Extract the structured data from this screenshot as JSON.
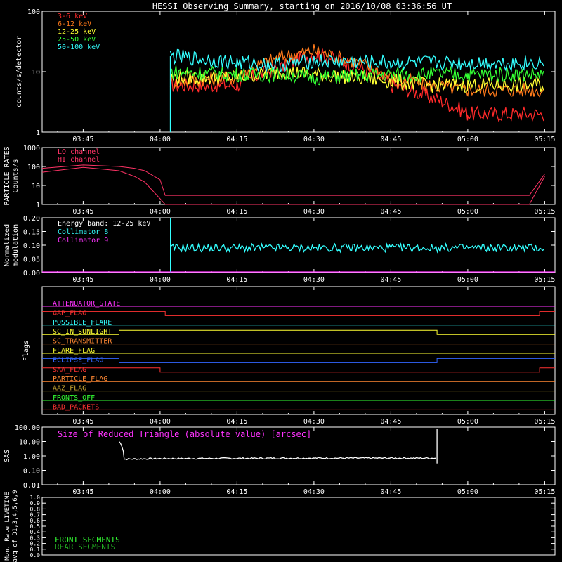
{
  "title": "HESSI Observing Summary, starting on 2016/10/08 03:36:56 UT",
  "time_ticks": [
    "03:45",
    "04:00",
    "04:15",
    "04:30",
    "04:45",
    "05:00",
    "05:15"
  ],
  "colors": {
    "background": "#000000",
    "axes": "#ffffff",
    "e3_6": "#ff2a2a",
    "e6_12": "#ff7a1a",
    "e12_25": "#ffff33",
    "e25_50": "#33ff33",
    "e50_100": "#33ffff",
    "particle_lo": "#ff3366",
    "particle_hi": "#ff3366",
    "coll8": "#33ffff",
    "coll9": "#ff33ff",
    "sas_title": "#ff33ff",
    "front_segments": "#33ff33",
    "rear_segments": "#22aa22"
  },
  "chart_data": [
    {
      "type": "line",
      "panel": "lightcurves",
      "ylabel": "counts/s/detector",
      "yscale": "log",
      "ylim": [
        1,
        100
      ],
      "ytick_labels": [
        "1",
        "10",
        "100"
      ],
      "legend": [
        "3-6 keV",
        "6-12 keV",
        "12-25 keV",
        "25-50 keV",
        "50-100 keV"
      ],
      "x": [
        "04:02",
        "04:15",
        "04:24",
        "04:30",
        "04:45",
        "04:52",
        "05:00",
        "05:15"
      ],
      "series": [
        {
          "name": "3-6 keV",
          "values": [
            6,
            6,
            12,
            20,
            6,
            4,
            2,
            2
          ]
        },
        {
          "name": "6-12 keV",
          "values": [
            7,
            8,
            18,
            22,
            8,
            6,
            5,
            5
          ]
        },
        {
          "name": "12-25 keV",
          "values": [
            8,
            8,
            10,
            9,
            7,
            6,
            6,
            6
          ]
        },
        {
          "name": "25-50 keV",
          "values": [
            10,
            9,
            9,
            8,
            9,
            9,
            9,
            9
          ]
        },
        {
          "name": "50-100 keV",
          "values": [
            18,
            14,
            13,
            15,
            14,
            14,
            14,
            14
          ]
        }
      ]
    },
    {
      "type": "line",
      "panel": "particle",
      "ylabel": "PARTICLE RATES Counts/s",
      "yscale": "log",
      "ylim": [
        1,
        1000
      ],
      "ytick_labels": [
        "1",
        "10",
        "100",
        "1000"
      ],
      "legend": [
        "LO channel",
        "HI channel"
      ],
      "x": [
        "03:37",
        "03:45",
        "03:52",
        "03:55",
        "03:57",
        "04:00",
        "04:01",
        "04:30",
        "05:00",
        "05:12",
        "05:15"
      ],
      "series": [
        {
          "name": "LO channel",
          "values": [
            80,
            120,
            100,
            80,
            60,
            20,
            3,
            3,
            3,
            3,
            40
          ]
        },
        {
          "name": "HI channel",
          "values": [
            50,
            90,
            60,
            30,
            15,
            2,
            1,
            1,
            1,
            1,
            30
          ]
        }
      ]
    },
    {
      "type": "line",
      "panel": "modulation",
      "ylabel": "Normalized modulation",
      "ylim": [
        0.0,
        0.2
      ],
      "ytick_labels": [
        "0.00",
        "0.05",
        "0.10",
        "0.15",
        "0.20"
      ],
      "annotation": "Energy band: 12-25 keV",
      "legend": [
        "Collimator 8",
        "Collimator 9"
      ],
      "series": [
        {
          "name": "Collimator 8",
          "x": [
            "04:02",
            "05:15"
          ],
          "values": [
            0.09,
            0.09
          ]
        },
        {
          "name": "Collimator 9",
          "x": [
            "03:37",
            "05:17"
          ],
          "values": [
            0.0,
            0.0
          ]
        }
      ]
    },
    {
      "type": "line",
      "panel": "flags",
      "ylabel": "Flags",
      "series": [
        {
          "name": "ATTENUATOR_STATE",
          "states": [
            {
              "from": "03:37",
              "to": "05:17",
              "v": 0
            }
          ]
        },
        {
          "name": "GAP_FLAG",
          "states": [
            {
              "from": "03:37",
              "to": "04:01",
              "v": 1
            },
            {
              "from": "04:01",
              "to": "05:14",
              "v": 0
            },
            {
              "from": "05:14",
              "to": "05:17",
              "v": 1
            }
          ]
        },
        {
          "name": "POSSIBLE_FLARE",
          "states": [
            {
              "from": "03:37",
              "to": "05:17",
              "v": 0
            }
          ]
        },
        {
          "name": "SC_IN_SUNLIGHT",
          "states": [
            {
              "from": "03:37",
              "to": "03:52",
              "v": 0
            },
            {
              "from": "03:52",
              "to": "04:54",
              "v": 1
            },
            {
              "from": "04:54",
              "to": "05:17",
              "v": 0
            }
          ]
        },
        {
          "name": "SC_TRANSMITTER",
          "states": [
            {
              "from": "03:37",
              "to": "05:17",
              "v": 0
            }
          ]
        },
        {
          "name": "FLARE_FLAG",
          "states": [
            {
              "from": "03:37",
              "to": "05:17",
              "v": 0
            }
          ]
        },
        {
          "name": "ECLIPSE_FLAG",
          "states": [
            {
              "from": "03:37",
              "to": "03:52",
              "v": 1
            },
            {
              "from": "03:52",
              "to": "04:54",
              "v": 0
            },
            {
              "from": "04:54",
              "to": "05:17",
              "v": 1
            }
          ]
        },
        {
          "name": "SAA_FLAG",
          "states": [
            {
              "from": "03:37",
              "to": "04:00",
              "v": 1
            },
            {
              "from": "04:00",
              "to": "05:14",
              "v": 0
            },
            {
              "from": "05:14",
              "to": "05:17",
              "v": 1
            }
          ]
        },
        {
          "name": "PARTICLE_FLAG",
          "states": [
            {
              "from": "03:37",
              "to": "05:17",
              "v": 0
            }
          ]
        },
        {
          "name": "AAZ_FLAG",
          "states": [
            {
              "from": "03:37",
              "to": "05:17",
              "v": 0
            }
          ]
        },
        {
          "name": "FRONTS_OFF",
          "states": [
            {
              "from": "03:37",
              "to": "05:17",
              "v": 0
            }
          ]
        },
        {
          "name": "BAD_PACKETS",
          "states": [
            {
              "from": "03:37",
              "to": "05:17",
              "v": 0
            }
          ]
        }
      ]
    },
    {
      "type": "line",
      "panel": "sas",
      "ylabel": "SAS",
      "yscale": "log",
      "ylim": [
        0.01,
        100
      ],
      "ytick_labels": [
        "0.01",
        "0.10",
        "1.00",
        "10.00",
        "100.00"
      ],
      "annotation": "Size of Reduced Triangle (absolute value) [arcsec]",
      "series": [
        {
          "name": "",
          "x": [
            "03:52",
            "03:53",
            "04:00",
            "04:30",
            "04:54"
          ],
          "values": [
            10,
            0.6,
            0.65,
            0.7,
            0.7
          ]
        }
      ]
    },
    {
      "type": "line",
      "panel": "livetime",
      "ylabel": "Mon. Rate LIVETIME avg of D1,3,4,5,6,9",
      "ylim": [
        0.0,
        1.0
      ],
      "ytick_labels": [
        "0.0",
        "0.1",
        "0.2",
        "0.3",
        "0.4",
        "0.5",
        "0.6",
        "0.7",
        "0.8",
        "0.9",
        "1.0"
      ],
      "legend": [
        "FRONT SEGMENTS",
        "REAR SEGMENTS"
      ],
      "series": []
    }
  ]
}
